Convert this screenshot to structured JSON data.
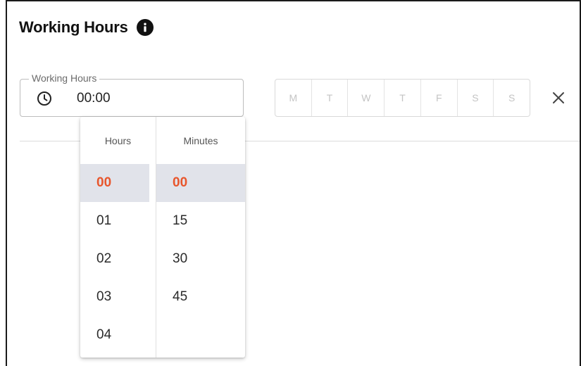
{
  "header": {
    "title": "Working Hours",
    "info_icon": "info-icon"
  },
  "field": {
    "label": "Working Hours",
    "value": "00:00",
    "icon": "clock-icon"
  },
  "days": [
    "M",
    "T",
    "W",
    "T",
    "F",
    "S",
    "S"
  ],
  "close_icon": "close-icon",
  "picker": {
    "hours_header": "Hours",
    "minutes_header": "Minutes",
    "hours": [
      "00",
      "01",
      "02",
      "03",
      "04"
    ],
    "minutes": [
      "00",
      "15",
      "30",
      "45"
    ],
    "selected_hour": "00",
    "selected_minute": "00"
  },
  "colors": {
    "accent": "#e8562c",
    "selected_bg": "#e1e3ea",
    "border": "#bdbdbd",
    "day_text": "#c4c4c4"
  }
}
